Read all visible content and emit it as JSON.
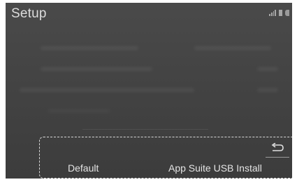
{
  "header": {
    "title": "Setup",
    "status_icons": [
      "signal-icon",
      "battery-icon",
      "status-dot-icon"
    ]
  },
  "footer": {
    "default_label": "Default",
    "usb_install_label": "App Suite USB Install",
    "back_icon": "back-arrow-icon"
  },
  "colors": {
    "screen_background": "#444444",
    "text": "#e4e4e4",
    "callout_border": "#d8d8d8"
  }
}
